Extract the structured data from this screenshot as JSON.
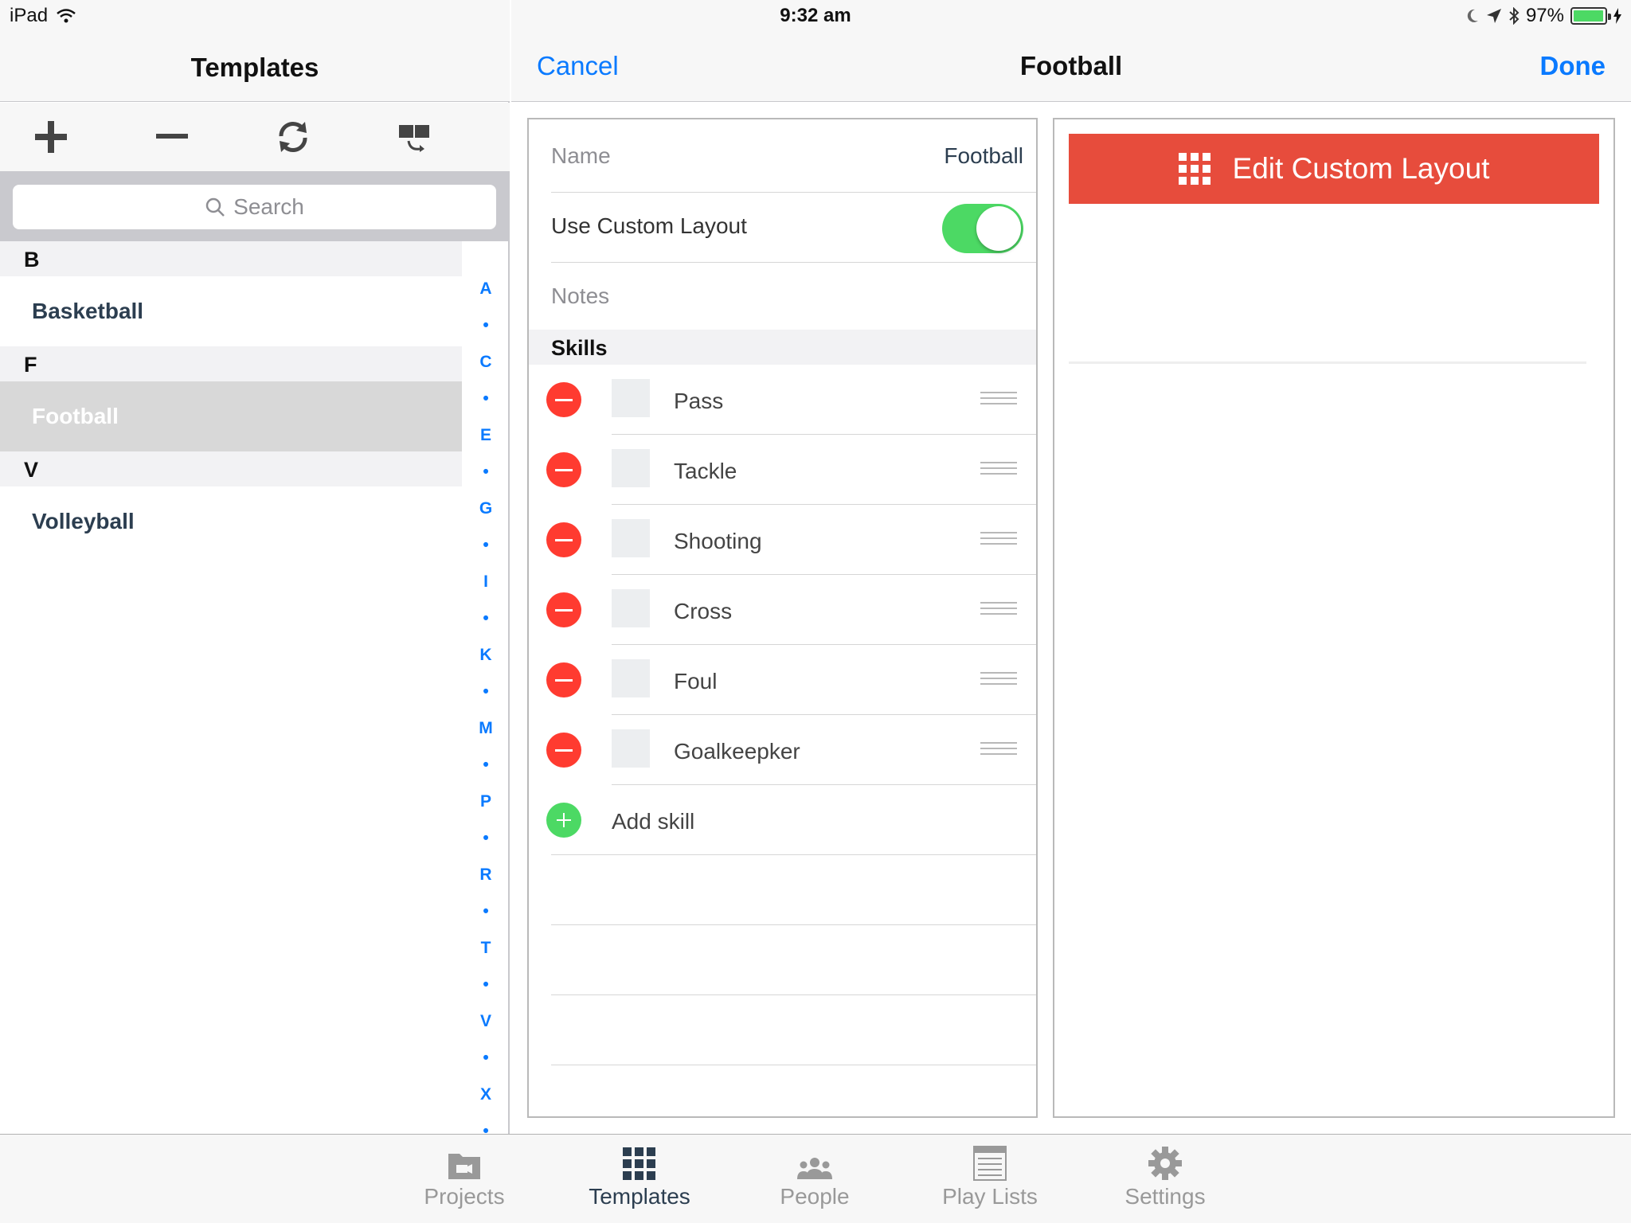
{
  "status_bar": {
    "device": "iPad",
    "time": "9:32 am",
    "battery": "97%",
    "battery_level": 0.97
  },
  "left_pane": {
    "title": "Templates",
    "toolbar": [
      "add-icon",
      "remove-icon",
      "sync-icon",
      "share-icon"
    ],
    "search_placeholder": "Search",
    "sections": [
      {
        "header": "B",
        "items": [
          "Basketball"
        ]
      },
      {
        "header": "F",
        "items": [
          "Football"
        ]
      },
      {
        "header": "V",
        "items": [
          "Volleyball"
        ]
      }
    ],
    "selected": "Football",
    "index": [
      "A",
      "•",
      "C",
      "•",
      "E",
      "•",
      "G",
      "•",
      "I",
      "•",
      "K",
      "•",
      "M",
      "•",
      "P",
      "•",
      "R",
      "•",
      "T",
      "•",
      "V",
      "•",
      "X",
      "•"
    ]
  },
  "detail": {
    "cancel": "Cancel",
    "title": "Football",
    "done": "Done",
    "name_label": "Name",
    "name_value": "Football",
    "custom_layout_label": "Use Custom Layout",
    "custom_layout_on": true,
    "notes_label": "Notes",
    "skills_header": "Skills",
    "skills": [
      "Pass",
      "Tackle",
      "Shooting",
      "Cross",
      "Foul",
      "Goalkeepker"
    ],
    "add_skill": "Add skill",
    "edit_layout": "Edit Custom Layout"
  },
  "tabs": [
    {
      "label": "Projects",
      "icon": "folder-camera-icon",
      "active": false
    },
    {
      "label": "Templates",
      "icon": "grid-icon",
      "active": true
    },
    {
      "label": "People",
      "icon": "people-icon",
      "active": false
    },
    {
      "label": "Play Lists",
      "icon": "list-icon",
      "active": false
    },
    {
      "label": "Settings",
      "icon": "gear-icon",
      "active": false
    }
  ],
  "colors": {
    "accent": "#0a7aff",
    "delete": "#ff3b30",
    "add": "#4cd964",
    "edit_button": "#e74c3c"
  }
}
